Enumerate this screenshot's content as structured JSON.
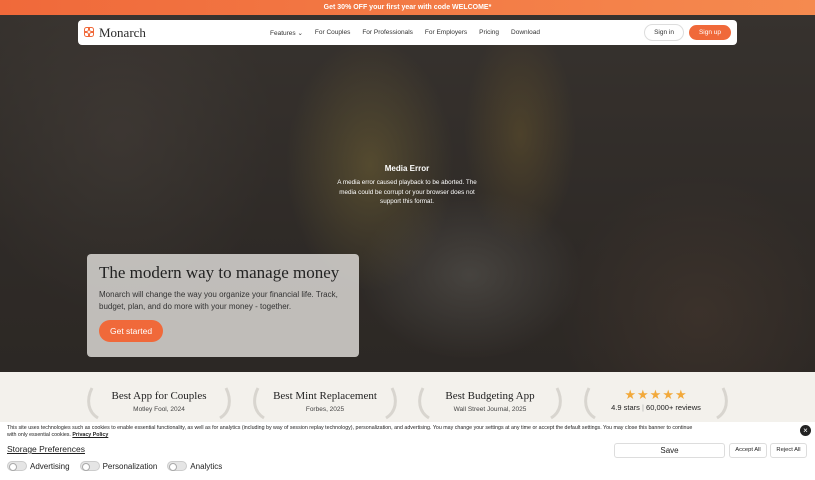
{
  "promo_banner": "Get 30% OFF your first year with code WELCOME*",
  "nav": {
    "logo_text": "Monarch",
    "links": [
      "Features",
      "For Couples",
      "For Professionals",
      "For Employers",
      "Pricing",
      "Download"
    ],
    "features_caret": "⌄",
    "signin": "Sign in",
    "signup": "Sign up"
  },
  "media_error": {
    "title": "Media Error",
    "message": "A media error caused playback to be aborted. The media could be corrupt or your browser does not support this format."
  },
  "hero": {
    "headline": "The modern way to manage money",
    "subtext": "Monarch will change the way you organize your financial life. Track, budget, plan, and do more with your money - together.",
    "cta": "Get started"
  },
  "awards": [
    {
      "title": "Best App for Couples",
      "source": "Motley Fool, 2024"
    },
    {
      "title": "Best Mint Replacement",
      "source": "Forbes, 2025"
    },
    {
      "title": "Best Budgeting App",
      "source": "Wall Street Journal, 2025"
    }
  ],
  "rating": {
    "stars": "★★★★★",
    "score": "4.9 stars",
    "separator": "|",
    "reviews": "60,000+ reviews"
  },
  "cookie": {
    "text": "This site uses technologies such as cookies to enable essential functionality, as well as for analytics (including by way of session replay technology), personalization, and advertising. You may change your settings at any time or accept the default settings. You may close this banner to continue with only essential cookies.",
    "policy_link": "Privacy Policy",
    "storage_title": "Storage Preferences",
    "toggles": [
      "Advertising",
      "Personalization",
      "Analytics"
    ],
    "save": "Save",
    "accept_all": "Accept All",
    "reject_all": "Reject All",
    "close": "×"
  },
  "colors": {
    "accent": "#f0693a",
    "star": "#f2a93b"
  }
}
